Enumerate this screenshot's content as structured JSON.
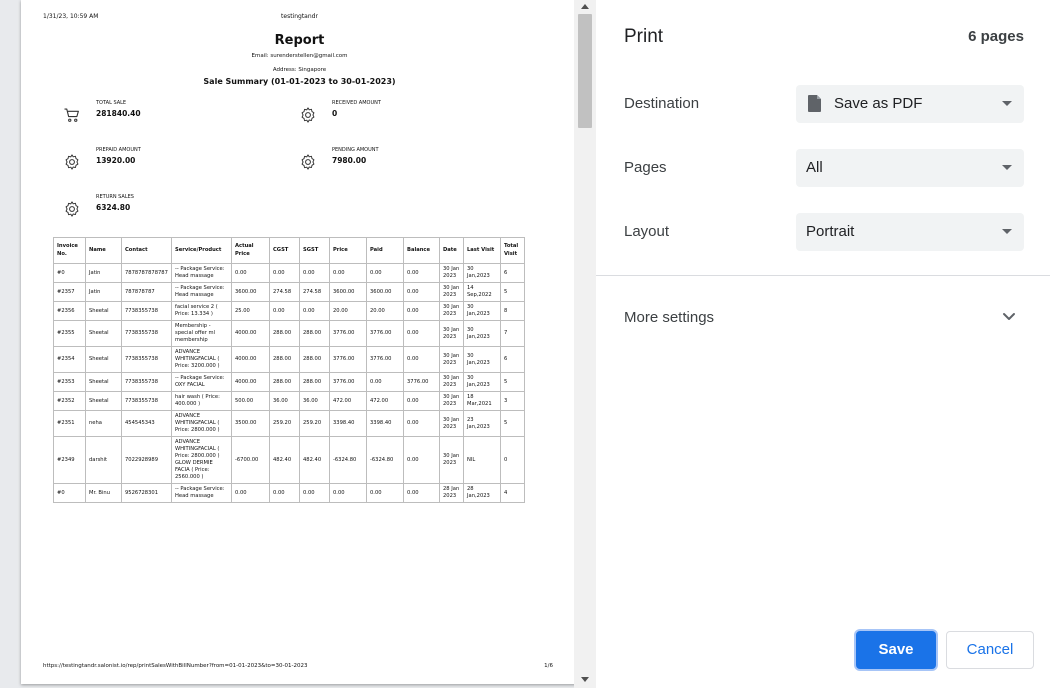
{
  "preview": {
    "header_datetime": "1/31/23, 10:59 AM",
    "header_title": "testingtandr",
    "report_title": "Report",
    "email": "Email: surenderstellen@gmail.com",
    "address": "Address: Singapore",
    "summary_title": "Sale Summary (01-01-2023 to 30-01-2023)",
    "stats": {
      "total_sale": {
        "label": "TOTAL SALE",
        "value": "281840.40",
        "icon": "cart-icon"
      },
      "received_amount": {
        "label": "RECEIVED AMOUNT",
        "value": "0",
        "icon": "gear-icon"
      },
      "prepaid_amount": {
        "label": "PREPAID AMOUNT",
        "value": "13920.00",
        "icon": "gear-icon"
      },
      "pending_amount": {
        "label": "PENDING AMOUNT",
        "value": "7980.00",
        "icon": "gear-icon"
      },
      "return_sales": {
        "label": "RETURN SALES",
        "value": "6324.80",
        "icon": "gear-icon"
      }
    },
    "table": {
      "columns": [
        "Invoice No.",
        "Name",
        "Contact",
        "Service/Product",
        "Actual Price",
        "CGST",
        "SGST",
        "Price",
        "Paid",
        "Balance",
        "Date",
        "Last Visit",
        "Total Visit"
      ],
      "rows": [
        [
          "#0",
          "Jatin",
          "7878787878787",
          "-- Package Service: Head massage",
          "0.00",
          "0.00",
          "0.00",
          "0.00",
          "0.00",
          "0.00",
          "30 Jan 2023",
          "30 Jan,2023",
          "6"
        ],
        [
          "#2357",
          "Jatin",
          "787878787",
          "-- Package Service: Head massage",
          "3600.00",
          "274.58",
          "274.58",
          "3600.00",
          "3600.00",
          "0.00",
          "30 Jan 2023",
          "14 Sep,2022",
          "5"
        ],
        [
          "#2356",
          "Sheetal",
          "7738355738",
          "facial service 2 ( Price: 13.334 )",
          "25.00",
          "0.00",
          "0.00",
          "20.00",
          "20.00",
          "0.00",
          "30 Jan 2023",
          "30 Jan,2023",
          "8"
        ],
        [
          "#2355",
          "Sheetal",
          "7738355738",
          "Membership - special offer ml membership",
          "4000.00",
          "288.00",
          "288.00",
          "3776.00",
          "3776.00",
          "0.00",
          "30 Jan 2023",
          "30 Jan,2023",
          "7"
        ],
        [
          "#2354",
          "Sheetal",
          "7738355738",
          "ADVANCE WHITINGFACIAL ( Price: 3200.000 )",
          "4000.00",
          "288.00",
          "288.00",
          "3776.00",
          "3776.00",
          "0.00",
          "30 Jan 2023",
          "30 Jan,2023",
          "6"
        ],
        [
          "#2353",
          "Sheetal",
          "7738355738",
          "-- Package Service: OXY FACIAL",
          "4000.00",
          "288.00",
          "288.00",
          "3776.00",
          "0.00",
          "3776.00",
          "30 Jan 2023",
          "30 Jan,2023",
          "5"
        ],
        [
          "#2352",
          "Sheetal",
          "7738355738",
          "hair wash ( Price: 400.000 )",
          "500.00",
          "36.00",
          "36.00",
          "472.00",
          "472.00",
          "0.00",
          "30 Jan 2023",
          "18 Mar,2021",
          "3"
        ],
        [
          "#2351",
          "neha",
          "454545343",
          "ADVANCE WHITINGFACIAL ( Price: 2800.000 )",
          "3500.00",
          "259.20",
          "259.20",
          "3398.40",
          "3398.40",
          "0.00",
          "30 Jan 2023",
          "23 Jan,2023",
          "5"
        ],
        [
          "#2349",
          "darshit",
          "7022928989",
          "ADVANCE WHITINGFACIAL ( Price: 2800.000 ) GLOW DERMIE FACIA ( Price: 2560.000 )",
          "-6700.00",
          "482.40",
          "482.40",
          "-6324.80",
          "-6324.80",
          "0.00",
          "30 Jan 2023",
          "NIL",
          "0"
        ],
        [
          "#0",
          "Mr. Binu",
          "9526728301",
          "-- Package Service: Head massage",
          "0.00",
          "0.00",
          "0.00",
          "0.00",
          "0.00",
          "0.00",
          "28 Jan 2023",
          "28 Jan,2023",
          "4"
        ]
      ]
    },
    "footer_url": "https://testingtandr.salonist.io/rep/printSalesWithBillNumber?from=01-01-2023&to=30-01-2023",
    "footer_page": "1/6"
  },
  "panel": {
    "title": "Print",
    "page_count": "6 pages",
    "destination": {
      "label": "Destination",
      "value": "Save as PDF",
      "icon": "document-icon"
    },
    "pages": {
      "label": "Pages",
      "value": "All"
    },
    "layout": {
      "label": "Layout",
      "value": "Portrait"
    },
    "more_settings": "More settings",
    "save_label": "Save",
    "cancel_label": "Cancel"
  },
  "colors": {
    "accent": "#1a73e8",
    "select_bg": "#f1f3f4",
    "preview_bg": "#e8eaed"
  }
}
